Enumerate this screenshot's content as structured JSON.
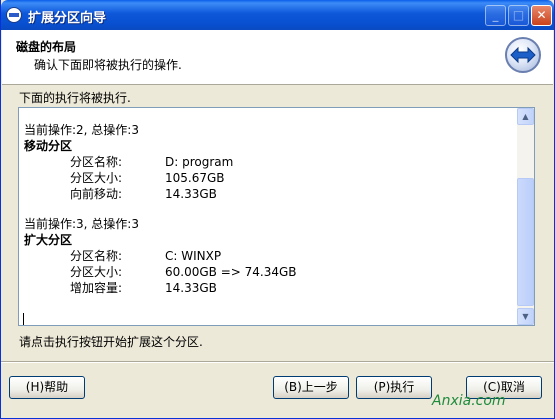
{
  "window": {
    "title": "扩展分区向导",
    "controls": {
      "minimize": "_",
      "maximize": "□",
      "close": "✕"
    }
  },
  "header": {
    "title": "磁盘的布局",
    "subtitle": "确认下面即将被执行的操作.",
    "icon": "double-arrow-icon"
  },
  "info_label": "下面的执行将被执行.",
  "operations": [
    {
      "step": "当前操作:2, 总操作:3",
      "name": "移动分区",
      "fields": [
        {
          "label": "分区名称:",
          "value": "D: program"
        },
        {
          "label": "分区大小:",
          "value": "105.67GB"
        },
        {
          "label": "向前移动:",
          "value": "14.33GB"
        }
      ]
    },
    {
      "step": "当前操作:3, 总操作:3",
      "name": "扩大分区",
      "fields": [
        {
          "label": "分区名称:",
          "value": "C: WINXP"
        },
        {
          "label": "分区大小:",
          "value": "60.00GB => 74.34GB"
        },
        {
          "label": "增加容量:",
          "value": "14.33GB"
        }
      ]
    }
  ],
  "hint": "请点击执行按钮开始扩展这个分区.",
  "buttons": {
    "help": "(H)帮助",
    "prev": "(B)上一步",
    "execute": "(P)执行",
    "cancel": "(C)取消"
  },
  "watermark": "Anxia.com"
}
